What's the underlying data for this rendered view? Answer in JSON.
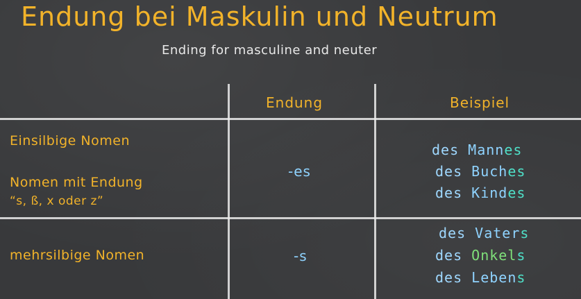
{
  "title": "Endung bei Maskulin und Neutrum",
  "subtitle": "Ending for masculine and neuter",
  "table": {
    "headers": {
      "endung": "Endung",
      "beispiel": "Beispiel"
    },
    "row1": {
      "label_line1": "Einsilbige Nomen",
      "label_line2": "Nomen mit Endung",
      "label_line3": "“s, ß, x oder z”",
      "ending": "-es",
      "examples": [
        {
          "article": "des ",
          "stem": "Mann",
          "suffix": "es"
        },
        {
          "article": "des ",
          "stem": "Buch",
          "suffix": "es"
        },
        {
          "article": "des ",
          "stem": "Kind",
          "suffix": "es"
        }
      ]
    },
    "row2": {
      "label": "mehrsilbige Nomen",
      "ending": "-s",
      "examples": [
        {
          "article": "des ",
          "stem": "Vater",
          "suffix": "s"
        },
        {
          "article": "des ",
          "stem": "Onkel",
          "suffix": "s"
        },
        {
          "article": "des ",
          "stem": "Leben",
          "suffix": "s"
        }
      ]
    }
  },
  "colors": {
    "title": "#f2b32a",
    "article": "#9fd8ff",
    "stem_blue": "#8fd3ff",
    "stem_green": "#7fe07a",
    "suffix_teal": "#4fe0c8",
    "chalk": "#e8e8e8"
  }
}
